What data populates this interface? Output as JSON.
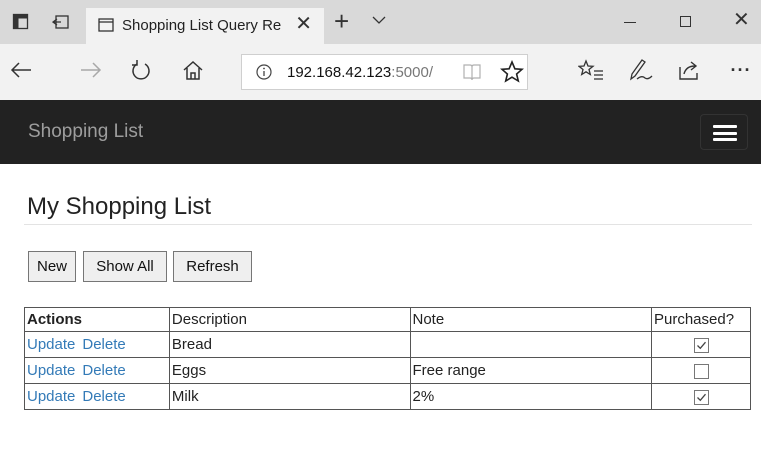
{
  "browser": {
    "tab_title": "Shopping List Query Re",
    "url_host": "192.168.42.123",
    "url_port": ":5000/",
    "icons": [
      "tab-actions-icon",
      "set-aside-tabs-icon",
      "page-icon",
      "close-icon",
      "new-tab-icon",
      "chevron-down-icon",
      "minimize-icon",
      "maximize-icon",
      "close-window-icon",
      "back-icon",
      "forward-icon",
      "refresh-icon",
      "home-icon",
      "info-icon",
      "reading-view-icon",
      "star-icon",
      "favorites-icon",
      "pen-icon",
      "share-icon",
      "more-icon"
    ],
    "more_label": "···"
  },
  "app": {
    "brand": "Shopping List",
    "header_color": "#222222"
  },
  "main": {
    "title": "My Shopping List",
    "buttons": {
      "new_label": "New",
      "show_all_label": "Show All",
      "refresh_label": "Refresh"
    },
    "table": {
      "headers": [
        "Actions",
        "Description",
        "Note",
        "Purchased?"
      ],
      "update_label": "Update",
      "delete_label": "Delete",
      "rows": [
        {
          "description": "Bread",
          "note": "",
          "purchased": true
        },
        {
          "description": "Eggs",
          "note": "Free range",
          "purchased": false
        },
        {
          "description": "Milk",
          "note": "2%",
          "purchased": true
        }
      ]
    }
  },
  "colors": {
    "link": "#337ab7"
  }
}
